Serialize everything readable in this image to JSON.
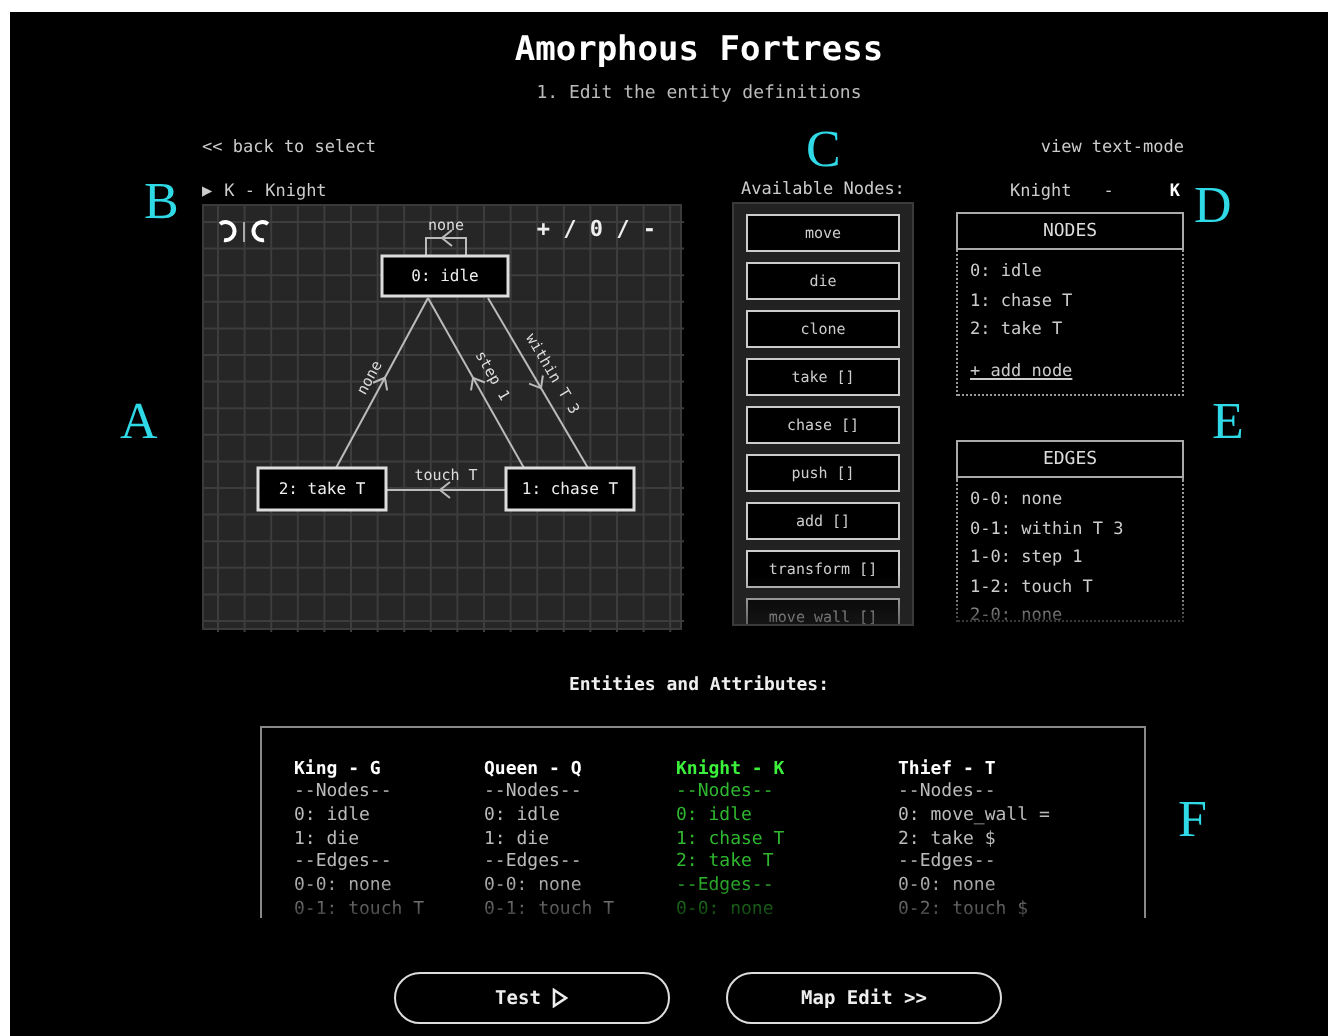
{
  "header": {
    "title": "Amorphous Fortress",
    "subtitle": "1. Edit the entity definitions"
  },
  "back_link": "<< back to select",
  "view_mode_link": "view text-mode",
  "entity_selector": {
    "toggle": "▶",
    "label": "K - Knight"
  },
  "graph": {
    "zoom_controls": "+ / 0 / -",
    "nodes": [
      {
        "label": "0: idle"
      },
      {
        "label": "1: chase T"
      },
      {
        "label": "2: take T"
      }
    ],
    "edges": [
      {
        "label": "none"
      },
      {
        "label": "within T 3"
      },
      {
        "label": "step 1"
      },
      {
        "label": "touch T"
      },
      {
        "label": "none"
      }
    ]
  },
  "palette": {
    "title": "Available Nodes:",
    "items": [
      "move",
      "die",
      "clone",
      "take []",
      "chase []",
      "push []",
      "add []",
      "transform []",
      "move_wall []"
    ]
  },
  "entity_info": {
    "name": "Knight",
    "separator": "-",
    "char": "K"
  },
  "nodes_panel": {
    "title": "NODES",
    "items": [
      "0: idle",
      "1: chase T",
      "2: take T"
    ],
    "add_link": "+ add node"
  },
  "edges_panel": {
    "title": "EDGES",
    "items": [
      "0-0: none",
      "0-1: within T 3",
      "1-0: step 1",
      "1-2: touch T",
      "2-0: none"
    ]
  },
  "entities": {
    "title": "Entities and Attributes:",
    "columns": [
      {
        "name": "King - G",
        "selected": false,
        "lines": [
          "--Nodes--",
          "0: idle",
          "1: die",
          "--Edges--",
          "0-0: none",
          "0-1: touch T"
        ]
      },
      {
        "name": "Queen - Q",
        "selected": false,
        "lines": [
          "--Nodes--",
          "0: idle",
          "1: die",
          "--Edges--",
          "0-0: none",
          "0-1: touch T"
        ]
      },
      {
        "name": "Knight - K",
        "selected": true,
        "lines": [
          "--Nodes--",
          "0: idle",
          "1: chase T",
          "2: take T",
          "--Edges--",
          "0-0: none"
        ]
      },
      {
        "name": "Thief - T",
        "selected": false,
        "lines": [
          "--Nodes--",
          "0: move_wall =",
          "2: take $",
          "--Edges--",
          "0-0: none",
          "0-2: touch $"
        ]
      }
    ]
  },
  "buttons": [
    {
      "label": "Test",
      "kind": "play"
    },
    {
      "label": "Map Edit >>",
      "kind": "plain"
    }
  ],
  "annotations": [
    "A",
    "B",
    "C",
    "D",
    "E",
    "F"
  ]
}
